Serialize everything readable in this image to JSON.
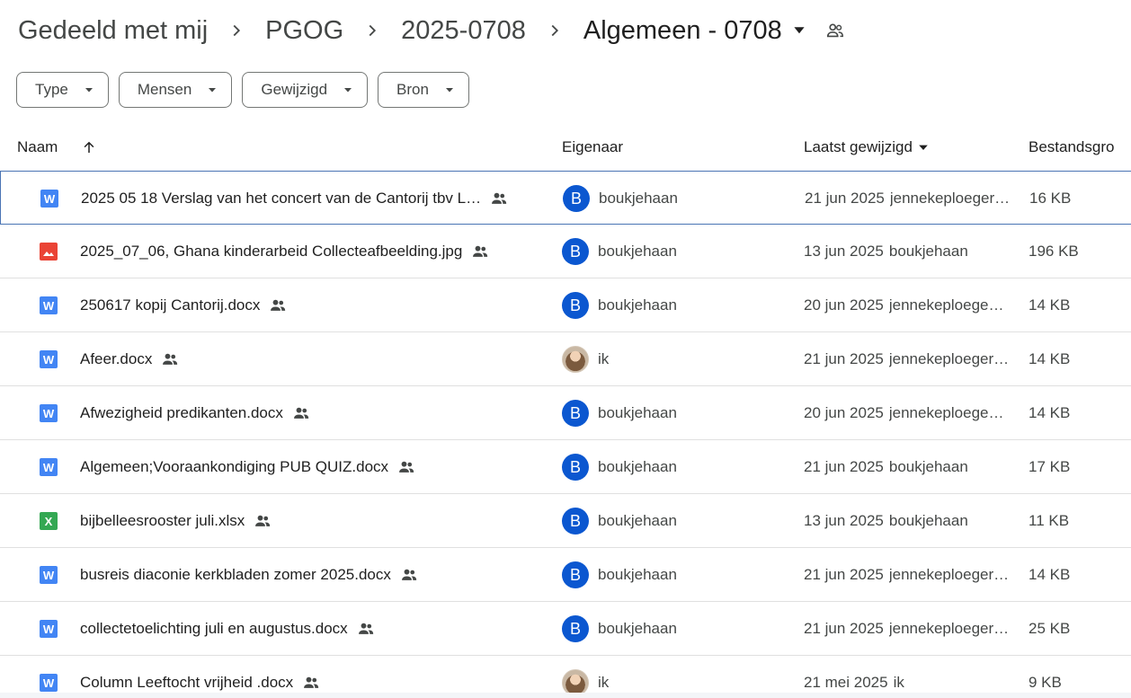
{
  "breadcrumb": {
    "items": [
      "Gedeeld met mij",
      "PGOG",
      "2025-0708"
    ],
    "current": "Algemeen - 0708"
  },
  "filters": [
    "Type",
    "Mensen",
    "Gewijzigd",
    "Bron"
  ],
  "columns": {
    "name": "Naam",
    "owner": "Eigenaar",
    "modified": "Laatst gewijzigd",
    "size": "Bestandsgro"
  },
  "icons": {
    "separator": "chevron-right-icon",
    "dropdown": "caret-down-icon",
    "shared": "people-icon",
    "sort": "arrow-up-icon"
  },
  "colors": {
    "docx": "#4285f4",
    "xlsx": "#34a853",
    "jpg": "#ea4335",
    "avatar": "#0b57d0",
    "selected_border": "#4a74b4"
  },
  "files": [
    {
      "type": "docx",
      "icon_letter": "W",
      "name": "2025 05 18 Verslag van het concert van de Cantorij tbv L…",
      "owner_avatar": "B",
      "owner": "boukjehaan",
      "date": "21 jun 2025",
      "by": "jennekeploeger…",
      "size": "16 KB",
      "selected": true
    },
    {
      "type": "jpg",
      "icon_letter": "",
      "name": "2025_07_06, Ghana kinderarbeid Collecteafbeelding.jpg",
      "owner_avatar": "B",
      "owner": "boukjehaan",
      "date": "13 jun 2025",
      "by": "boukjehaan",
      "size": "196 KB"
    },
    {
      "type": "docx",
      "icon_letter": "W",
      "name": "250617 kopij Cantorij.docx",
      "owner_avatar": "B",
      "owner": "boukjehaan",
      "date": "20 jun 2025",
      "by": "jennekeploege…",
      "size": "14 KB"
    },
    {
      "type": "docx",
      "icon_letter": "W",
      "name": "Afeer.docx",
      "owner_avatar": "",
      "owner": "ik",
      "date": "21 jun 2025",
      "by": "jennekeploeger…",
      "size": "14 KB"
    },
    {
      "type": "docx",
      "icon_letter": "W",
      "name": "Afwezigheid predikanten.docx",
      "owner_avatar": "B",
      "owner": "boukjehaan",
      "date": "20 jun 2025",
      "by": "jennekeploege…",
      "size": "14 KB"
    },
    {
      "type": "docx",
      "icon_letter": "W",
      "name": "Algemeen;Vooraankondiging PUB QUIZ.docx",
      "owner_avatar": "B",
      "owner": "boukjehaan",
      "date": "21 jun 2025",
      "by": "boukjehaan",
      "size": "17 KB"
    },
    {
      "type": "xlsx",
      "icon_letter": "X",
      "name": "bijbelleesrooster juli.xlsx",
      "owner_avatar": "B",
      "owner": "boukjehaan",
      "date": "13 jun 2025",
      "by": "boukjehaan",
      "size": "11 KB"
    },
    {
      "type": "docx",
      "icon_letter": "W",
      "name": "busreis diaconie kerkbladen zomer 2025.docx",
      "owner_avatar": "B",
      "owner": "boukjehaan",
      "date": "21 jun 2025",
      "by": "jennekeploeger…",
      "size": "14 KB"
    },
    {
      "type": "docx",
      "icon_letter": "W",
      "name": "collectetoelichting juli en augustus.docx",
      "owner_avatar": "B",
      "owner": "boukjehaan",
      "date": "21 jun 2025",
      "by": "jennekeploeger…",
      "size": "25 KB"
    },
    {
      "type": "docx",
      "icon_letter": "W",
      "name": "Column Leeftocht vrijheid .docx",
      "owner_avatar": "",
      "owner": "ik",
      "date": "21 mei 2025",
      "by": "ik",
      "size": "9 KB"
    }
  ]
}
